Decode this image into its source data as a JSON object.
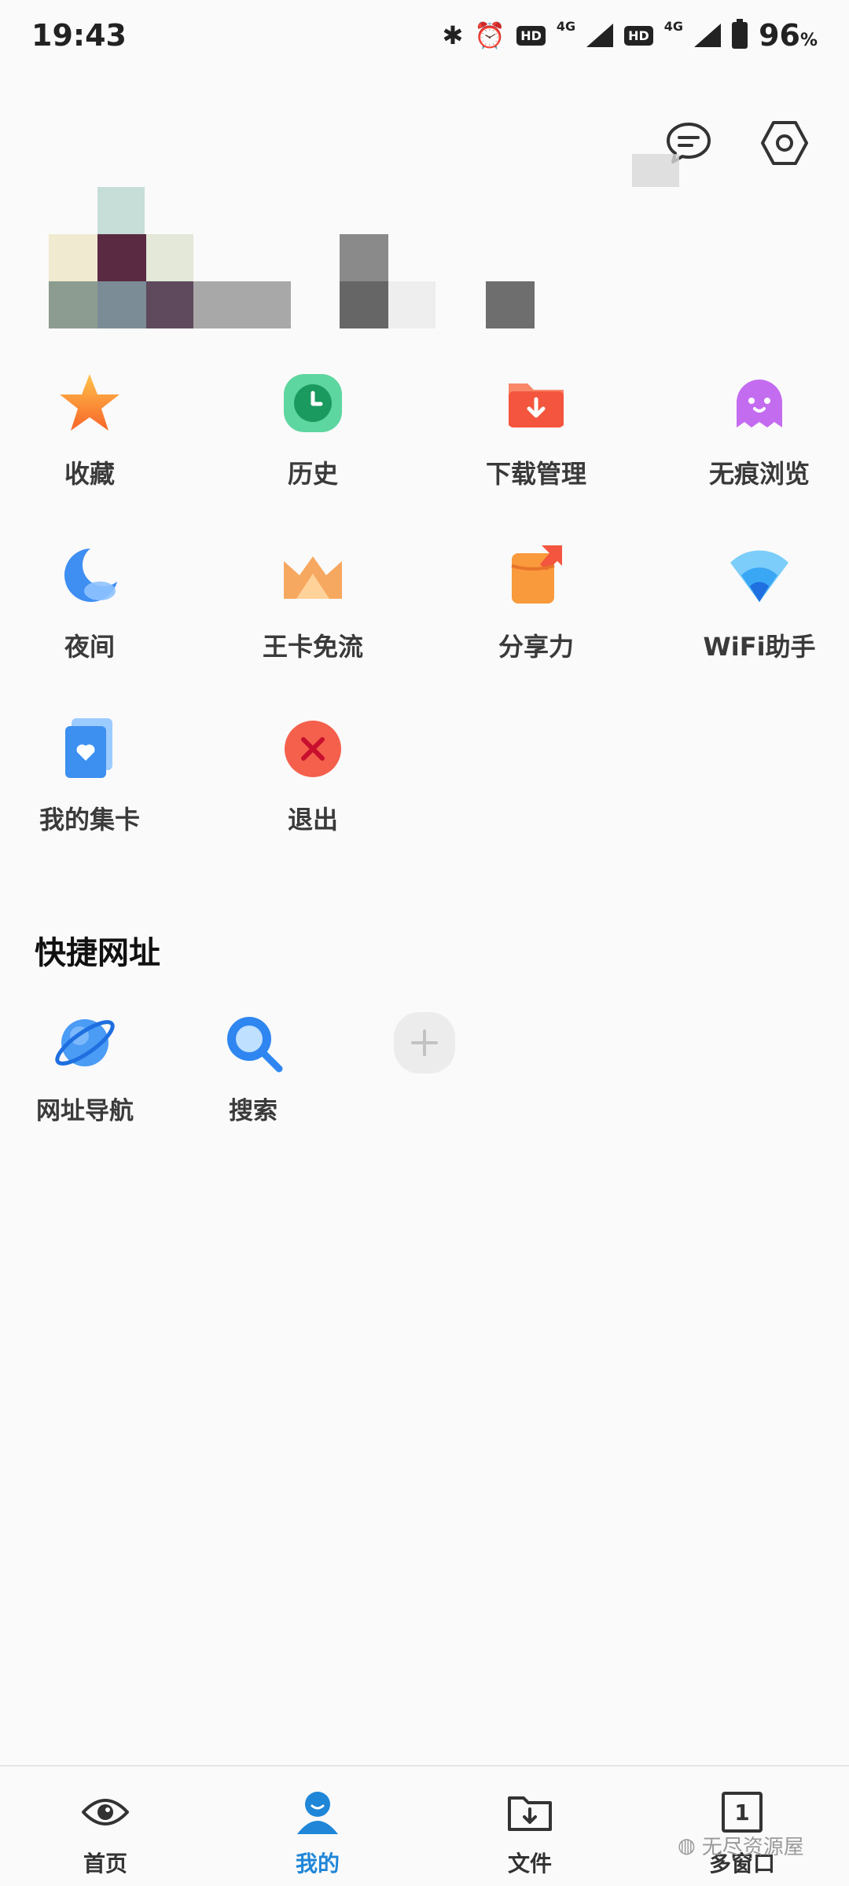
{
  "status_bar": {
    "time": "19:43",
    "network_1": "4G",
    "network_2": "4G",
    "hd_label": "HD",
    "battery": "96",
    "battery_unit": "%"
  },
  "header": {
    "message_icon": "chat-bubble-icon",
    "settings_icon": "hexagon-gear-icon"
  },
  "grid": {
    "items": [
      {
        "label": "收藏",
        "icon": "star-icon",
        "color": "#f7a335"
      },
      {
        "label": "历史",
        "icon": "clock-icon",
        "color": "#3ccf8e"
      },
      {
        "label": "下载管理",
        "icon": "download-folder-icon",
        "color": "#f5614a"
      },
      {
        "label": "无痕浏览",
        "icon": "ghost-icon",
        "color": "#c46cf0"
      },
      {
        "label": "夜间",
        "icon": "moon-icon",
        "color": "#3f8ef2"
      },
      {
        "label": "王卡免流",
        "icon": "crown-icon",
        "color": "#f59a55"
      },
      {
        "label": "分享力",
        "icon": "share-gift-icon",
        "color": "#f78a38"
      },
      {
        "label": "WiFi助手",
        "icon": "wifi-icon",
        "color": "#3aa7f4"
      },
      {
        "label": "我的集卡",
        "icon": "card-heart-icon",
        "color": "#3d8ff0"
      },
      {
        "label": "退出",
        "icon": "exit-x-icon",
        "color": "#f05a4c"
      }
    ]
  },
  "quick_links": {
    "title": "快捷网址",
    "items": [
      {
        "label": "网址导航",
        "icon": "planet-icon"
      },
      {
        "label": "搜索",
        "icon": "search-icon"
      }
    ],
    "add_icon": "plus-icon"
  },
  "bottom_nav": {
    "items": [
      {
        "label": "首页",
        "icon": "eye-icon"
      },
      {
        "label": "我的",
        "icon": "person-icon"
      },
      {
        "label": "文件",
        "icon": "file-download-icon"
      },
      {
        "label": "多窗口",
        "icon": "window-count-icon",
        "badge": "1"
      }
    ]
  },
  "watermark": "无尽资源屋"
}
